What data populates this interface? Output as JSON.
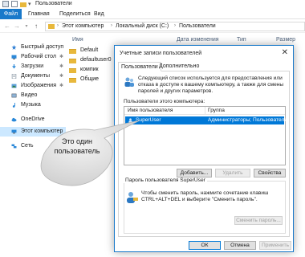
{
  "window": {
    "title": "Пользователи"
  },
  "ribbon": {
    "file": "Файл",
    "tabs": [
      "Главная",
      "Поделиться",
      "Вид"
    ]
  },
  "address": {
    "crumbs": [
      "Этот компьютер",
      "Локальный диск (C:)",
      "Пользователи"
    ]
  },
  "columns": {
    "name": "Имя",
    "date": "Дата изменения",
    "type": "Тип",
    "size": "Размер"
  },
  "sidebar": {
    "items": [
      {
        "label": "Быстрый доступ",
        "icon": "star-icon"
      },
      {
        "label": "Рабочий стол",
        "icon": "desktop-icon",
        "pinned": true
      },
      {
        "label": "Загрузки",
        "icon": "download-icon",
        "pinned": true
      },
      {
        "label": "Документы",
        "icon": "documents-icon",
        "pinned": true
      },
      {
        "label": "Изображения",
        "icon": "pictures-icon",
        "pinned": true
      },
      {
        "label": "Видео",
        "icon": "video-icon"
      },
      {
        "label": "Музыка",
        "icon": "music-icon"
      },
      {
        "label": "OneDrive",
        "icon": "cloud-icon"
      },
      {
        "label": "Этот компьютер",
        "icon": "computer-icon",
        "selected": true
      },
      {
        "label": "Сеть",
        "icon": "network-icon"
      }
    ],
    "pin_glyph": "✱"
  },
  "files": [
    {
      "name": "Default"
    },
    {
      "name": "defaultuser0"
    },
    {
      "name": "компик"
    },
    {
      "name": "Общие"
    }
  ],
  "callout": {
    "line1": "Это один",
    "line2": "пользователь"
  },
  "dialog": {
    "title": "Учетные записи пользователей",
    "close": "✕",
    "tabs": [
      "Пользователи",
      "Дополнительно"
    ],
    "info": "Следующий список используется для предоставления или отказа в доступе к вашему компьютеру, а также для смены паролей и других параметров.",
    "users_label": "Пользователи этого компьютера:",
    "list_headers": {
      "name": "Имя пользователя",
      "group": "Группа"
    },
    "user": {
      "name": "SuperUser",
      "group": "Администраторы; Пользователи"
    },
    "buttons": {
      "add": "Добавить...",
      "remove": "Удалить",
      "properties": "Свойства"
    },
    "password_group": "Пароль пользователя SuperUser",
    "password_text": "Чтобы сменить пароль, нажмите сочетание клавиш CTRL+ALT+DEL и выберите \"Сменить пароль\".",
    "reset_button": "Сменить пароль...",
    "footer": {
      "ok": "ОК",
      "cancel": "Отмена",
      "apply": "Применить"
    }
  },
  "colors": {
    "accent": "#0078d7",
    "folder": "#e8b83c",
    "file_tab": "#1979ca",
    "nav_selected": "#cce8ff"
  }
}
